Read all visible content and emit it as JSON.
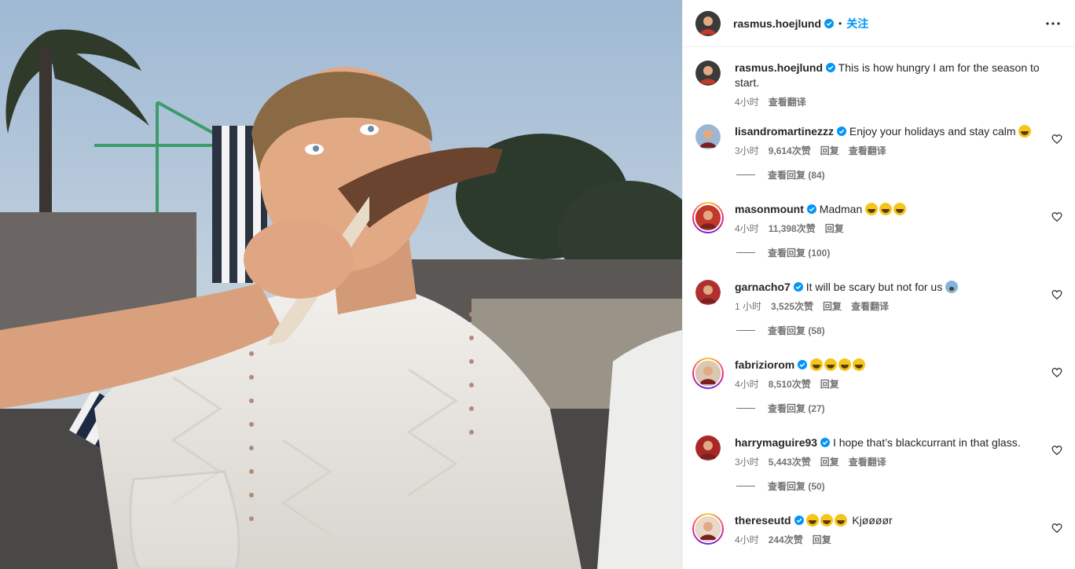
{
  "post": {
    "author": "rasmus.hoejlund",
    "follow_label": "关注",
    "caption": "This is how hungry I am for the season to start.",
    "caption_time": "4小时",
    "translate_label": "查看翻译"
  },
  "labels": {
    "reply": "回复",
    "translate": "查看翻译"
  },
  "comments": [
    {
      "user": "lisandromartinezzz",
      "text": "Enjoy your holidays and stay calm",
      "emojis": 1,
      "time": "3小时",
      "likes": "9,614次赞",
      "translate": true,
      "view_replies": "查看回复 (84)",
      "ring": false
    },
    {
      "user": "masonmount",
      "text": "Madman",
      "emojis": 3,
      "time": "4小时",
      "likes": "11,398次赞",
      "translate": false,
      "view_replies": "查看回复 (100)",
      "ring": true
    },
    {
      "user": "garnacho7",
      "text": "It will be scary but not for us",
      "emojis": 1,
      "emoji_type": "fear",
      "time": "1 小时",
      "likes": "3,525次赞",
      "translate": true,
      "view_replies": "查看回复 (58)",
      "ring": false
    },
    {
      "user": "fabriziorom",
      "text": "",
      "emojis": 4,
      "time": "4小时",
      "likes": "8,510次赞",
      "translate": false,
      "view_replies": "查看回复 (27)",
      "ring": true
    },
    {
      "user": "harrymaguire93",
      "text": "I hope that’s blackcurrant in that glass.",
      "emojis": 0,
      "time": "3小时",
      "likes": "5,443次赞",
      "translate": true,
      "view_replies": "查看回复 (50)",
      "ring": false
    },
    {
      "user": "thereseutd",
      "text": "Kjøøøør",
      "emojis": 3,
      "emojis_first": true,
      "time": "4小时",
      "likes": "244次赞",
      "translate": false,
      "view_replies": "",
      "ring": true
    }
  ],
  "colors": {
    "link": "#0095f6",
    "verified": "#0095f6",
    "secondary_text": "#737373"
  }
}
